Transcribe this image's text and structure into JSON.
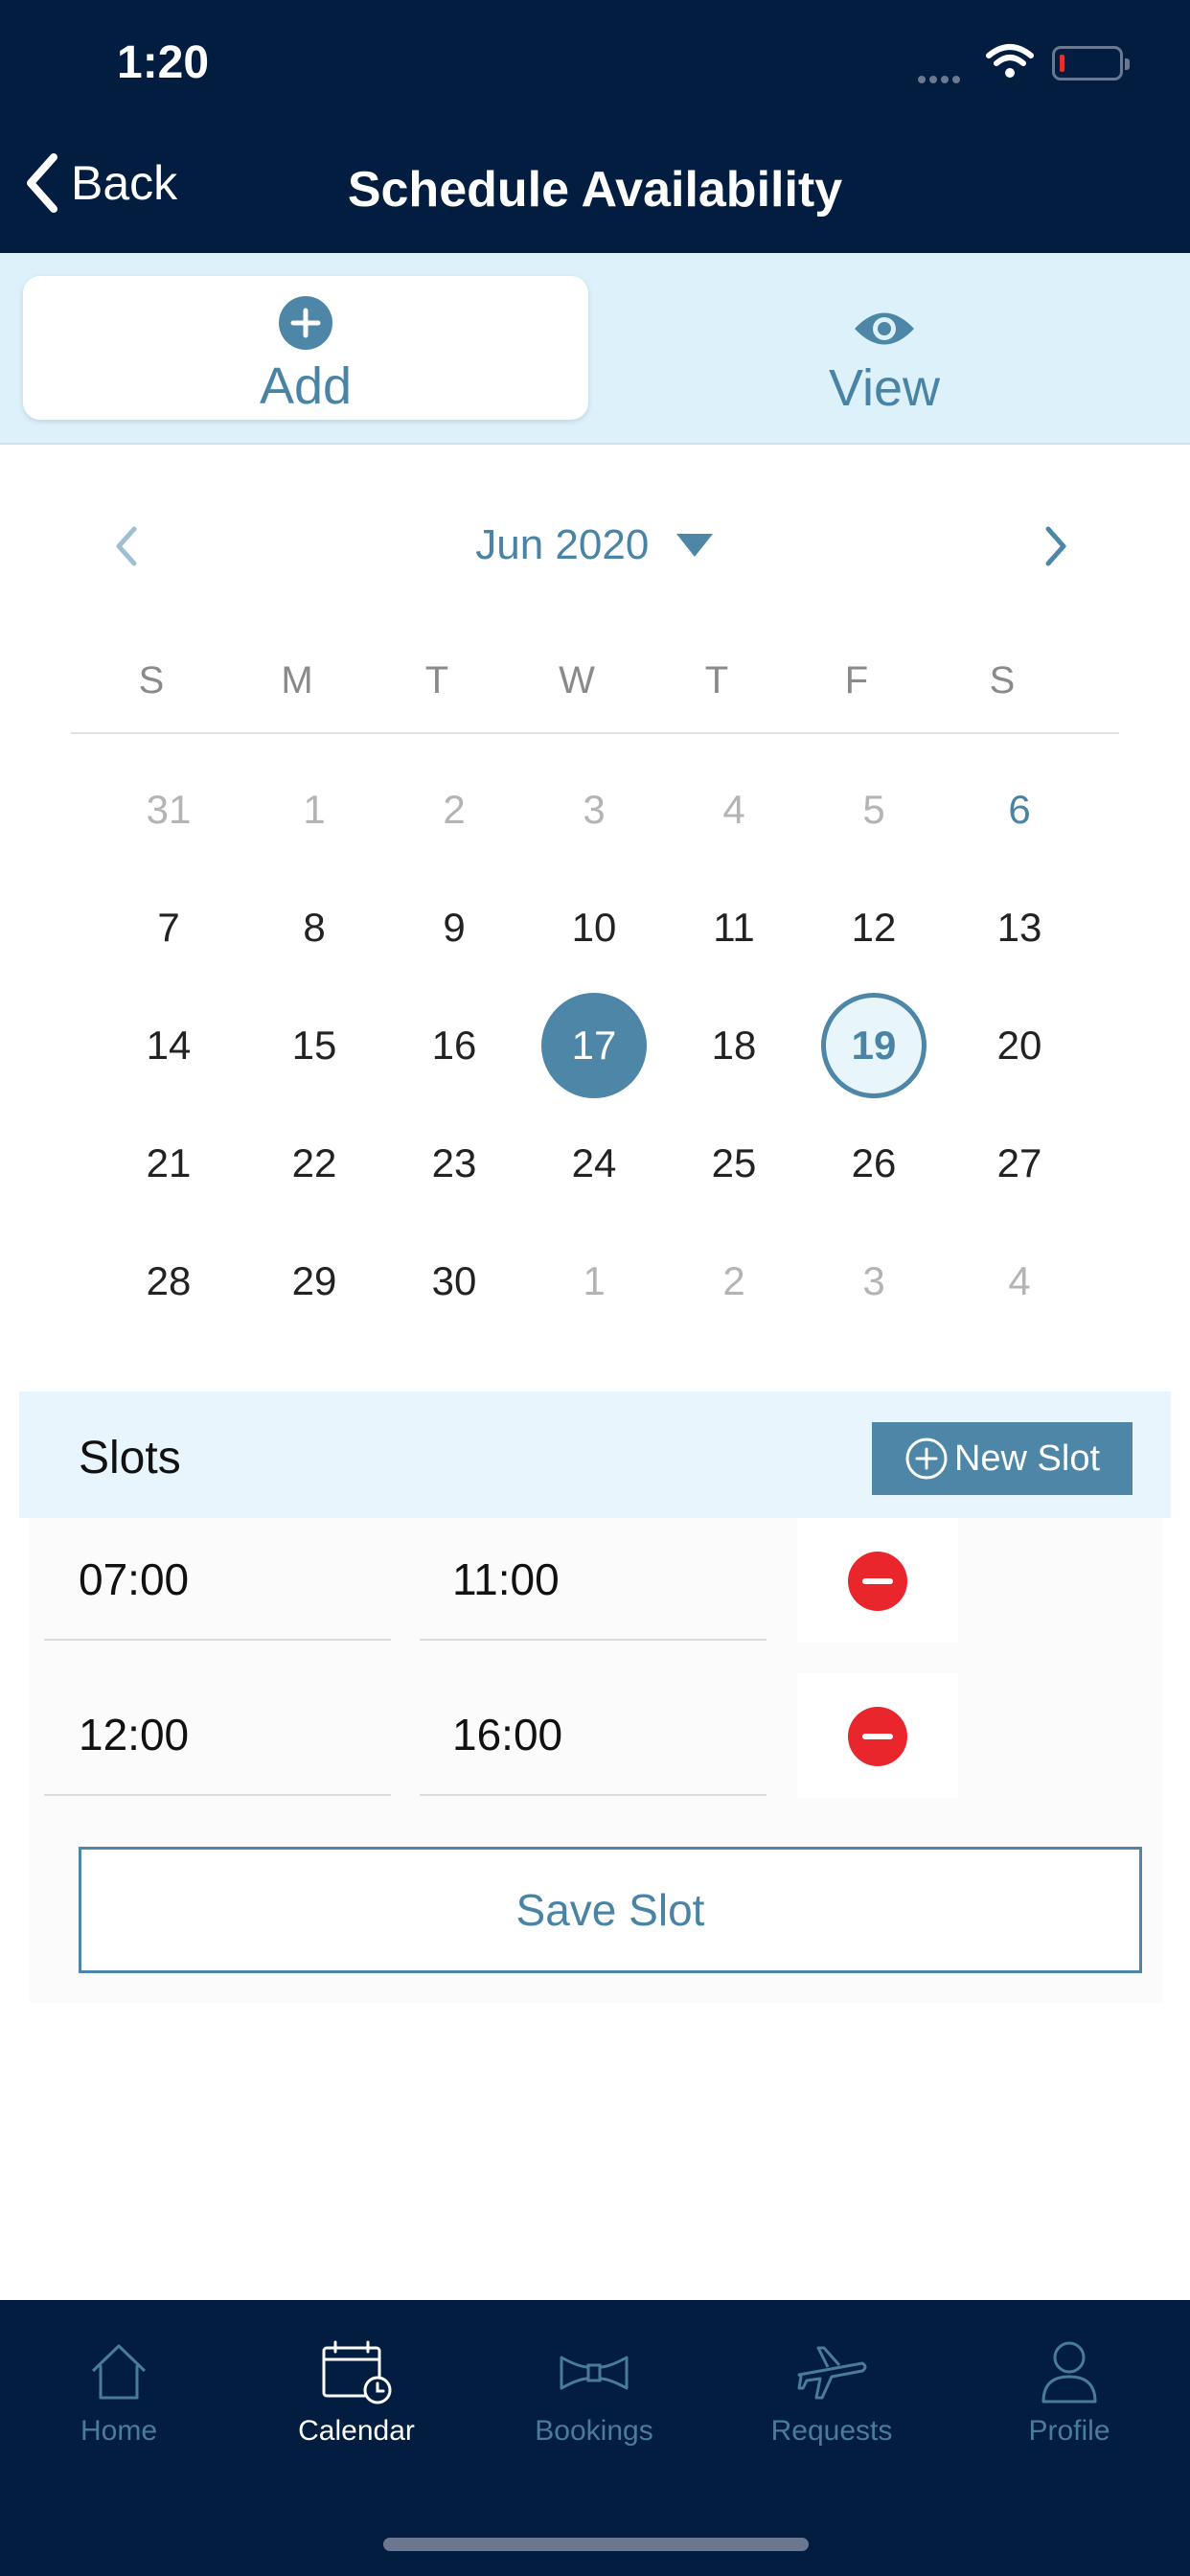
{
  "status_bar": {
    "time": "1:20"
  },
  "header": {
    "back_label": "Back",
    "title": "Schedule Availability"
  },
  "segments": {
    "add_label": "Add",
    "view_label": "View",
    "active": "add"
  },
  "calendar": {
    "month_label": "Jun 2020",
    "weekdays": [
      "S",
      "M",
      "T",
      "W",
      "T",
      "F",
      "S"
    ],
    "weeks": [
      [
        {
          "d": "31",
          "other": true
        },
        {
          "d": "1",
          "other": true
        },
        {
          "d": "2",
          "other": true
        },
        {
          "d": "3",
          "other": true
        },
        {
          "d": "4",
          "other": true
        },
        {
          "d": "5",
          "other": true
        },
        {
          "d": "6",
          "accent": true
        }
      ],
      [
        {
          "d": "7"
        },
        {
          "d": "8"
        },
        {
          "d": "9"
        },
        {
          "d": "10"
        },
        {
          "d": "11"
        },
        {
          "d": "12"
        },
        {
          "d": "13"
        }
      ],
      [
        {
          "d": "14"
        },
        {
          "d": "15"
        },
        {
          "d": "16"
        },
        {
          "d": "17",
          "selected": true
        },
        {
          "d": "18"
        },
        {
          "d": "19",
          "today": true
        },
        {
          "d": "20"
        }
      ],
      [
        {
          "d": "21"
        },
        {
          "d": "22"
        },
        {
          "d": "23"
        },
        {
          "d": "24"
        },
        {
          "d": "25"
        },
        {
          "d": "26"
        },
        {
          "d": "27"
        }
      ],
      [
        {
          "d": "28"
        },
        {
          "d": "29"
        },
        {
          "d": "30"
        },
        {
          "d": "1",
          "other": true
        },
        {
          "d": "2",
          "other": true
        },
        {
          "d": "3",
          "other": true
        },
        {
          "d": "4",
          "other": true
        }
      ]
    ],
    "selected_day": "17",
    "today_day": "19"
  },
  "slots": {
    "title": "Slots",
    "new_slot_label": "New Slot",
    "rows": [
      {
        "start": "07:00",
        "end": "11:00"
      },
      {
        "start": "12:00",
        "end": "16:00"
      }
    ],
    "save_label": "Save Slot"
  },
  "tabbar": {
    "items": [
      {
        "label": "Home",
        "icon": "home-icon"
      },
      {
        "label": "Calendar",
        "icon": "calendar-icon",
        "active": true
      },
      {
        "label": "Bookings",
        "icon": "bowtie-icon"
      },
      {
        "label": "Requests",
        "icon": "airplane-icon"
      },
      {
        "label": "Profile",
        "icon": "person-icon"
      }
    ]
  },
  "colors": {
    "navy": "#021d3f",
    "accent": "#4d86a6",
    "light_blue": "#dcf1fa",
    "remove_red": "#e8262b"
  }
}
